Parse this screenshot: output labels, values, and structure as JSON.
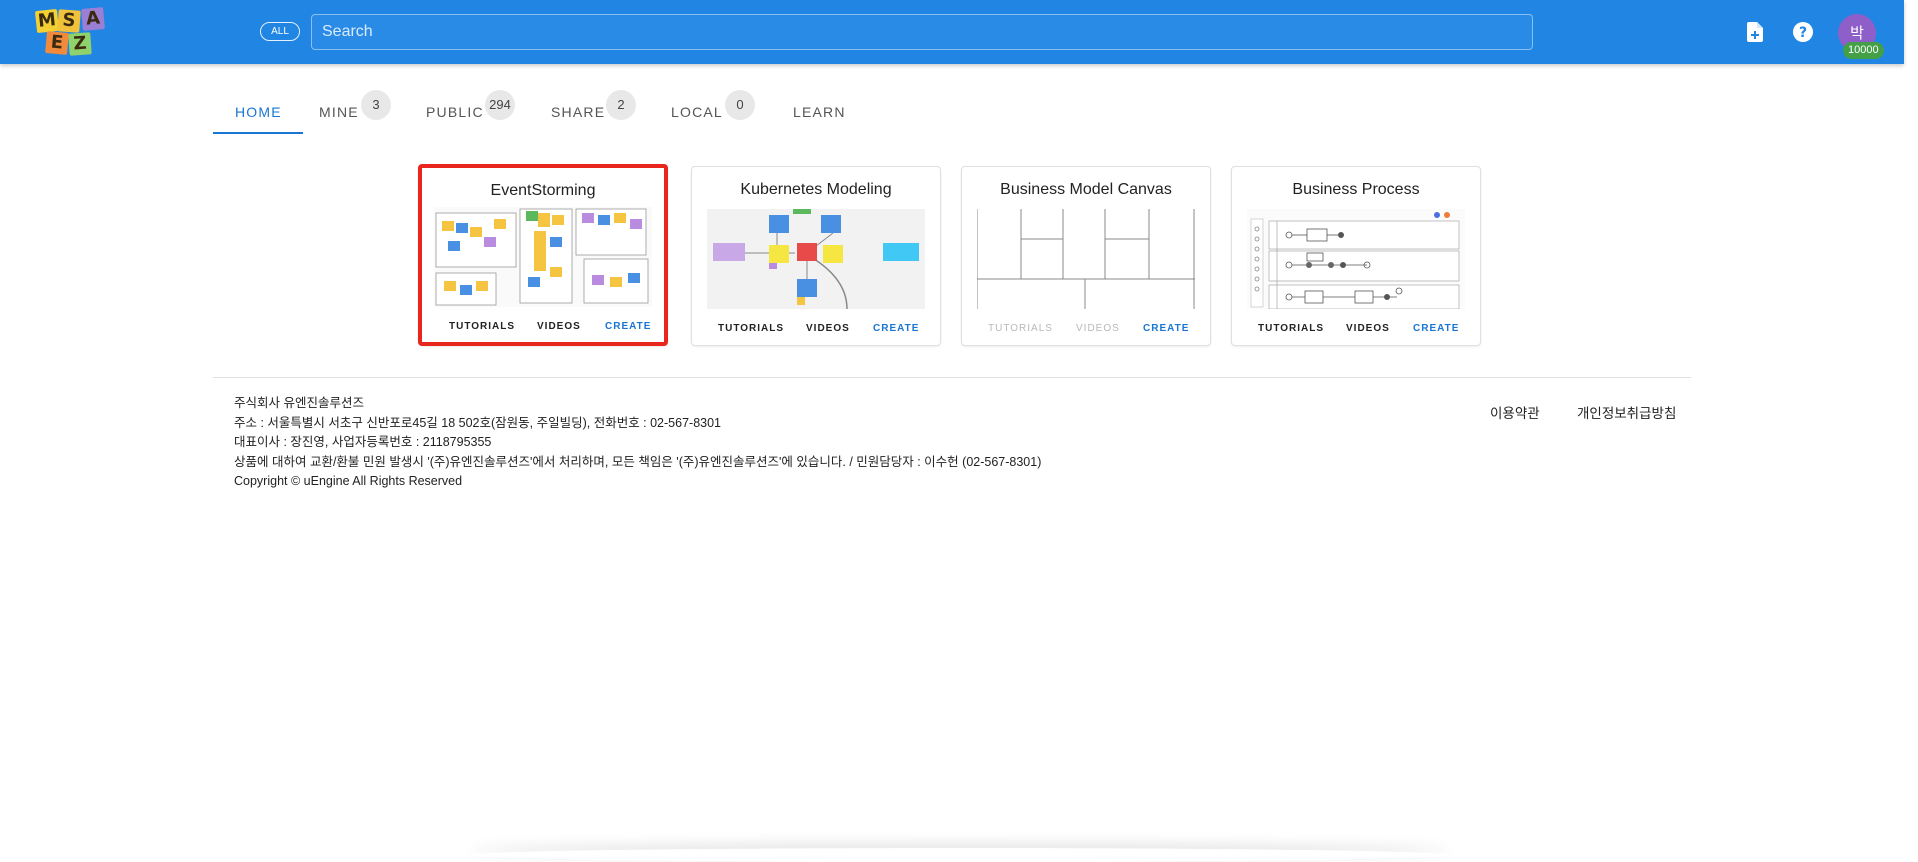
{
  "header": {
    "logo_letters": [
      "M",
      "S",
      "A",
      "E",
      "Z"
    ],
    "all_label": "ALL",
    "search_placeholder": "Search",
    "new_file_icon": "new-file-icon",
    "help_icon": "help-icon",
    "avatar_initial": "박",
    "credit": "10000",
    "colors": {
      "bar": "#2185e3",
      "avatar": "#8e5fc8",
      "credit": "#43a047"
    }
  },
  "tabs": [
    {
      "label": "HOME",
      "active": true
    },
    {
      "label": "MINE",
      "count": "3"
    },
    {
      "label": "PUBLIC",
      "count": "294"
    },
    {
      "label": "SHARE",
      "count": "2"
    },
    {
      "label": "LOCAL",
      "count": "0"
    },
    {
      "label": "LEARN"
    }
  ],
  "cards": [
    {
      "title": "EventStorming",
      "tutorials": "TUTORIALS",
      "videos": "VIDEOS",
      "create": "CREATE",
      "selected": true
    },
    {
      "title": "Kubernetes Modeling",
      "tutorials": "TUTORIALS",
      "videos": "VIDEOS",
      "create": "CREATE"
    },
    {
      "title": "Business Model Canvas",
      "tutorials": "TUTORIALS",
      "videos": "VIDEOS",
      "create": "CREATE",
      "disabled": [
        "tutorials",
        "videos"
      ]
    },
    {
      "title": "Business Process",
      "tutorials": "TUTORIALS",
      "videos": "VIDEOS",
      "create": "CREATE"
    }
  ],
  "footer": {
    "company": "주식회사 유엔진솔루션즈",
    "address": "주소 : 서울특별시 서초구 신반포로45길 18 502호(잠원동, 주일빌딩), 전화번호 : 02-567-8301",
    "ceo": "대표이사 : 장진영, 사업자등록번호 : 2118795355",
    "notice": "상품에 대하여 교환/환불 민원 발생시 '(주)유엔진솔루션즈'에서 처리하며, 모든 책임은 '(주)유엔진솔루션즈'에 있습니다. / 민원담당자 : 이수헌 (02-567-8301)",
    "copyright": "Copyright © uEngine All Rights Reserved",
    "terms": "이용약관",
    "privacy": "개인정보취급방침"
  }
}
